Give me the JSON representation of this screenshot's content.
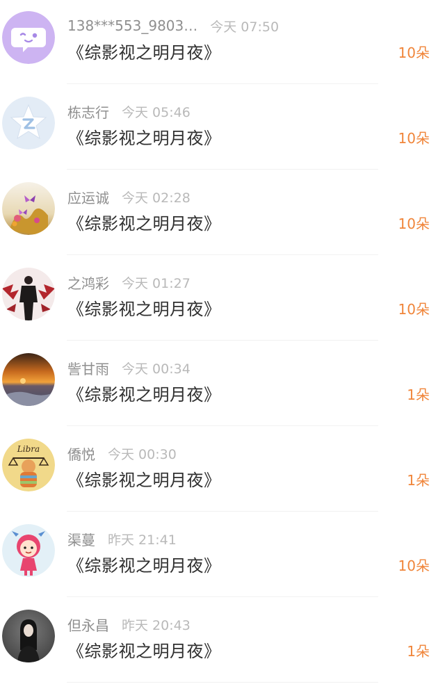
{
  "gift_list": {
    "items": [
      {
        "user": "138***553_9803…",
        "time": "今天 07:50",
        "book": "《综影视之明月夜》",
        "gift": "10朵",
        "avatar": "wechat-smiley-avatar"
      },
      {
        "user": "栋志行",
        "time": "今天 05:46",
        "book": "《综影视之明月夜》",
        "gift": "10朵",
        "avatar": "qzone-star-avatar"
      },
      {
        "user": "应运诚",
        "time": "今天 02:28",
        "book": "《综影视之明月夜》",
        "gift": "10朵",
        "avatar": "butterfly-flowers-avatar"
      },
      {
        "user": "之鸿彩",
        "time": "今天 01:27",
        "book": "《综影视之明月夜》",
        "gift": "10朵",
        "avatar": "man-in-black-avatar"
      },
      {
        "user": "訾甘雨",
        "time": "今天 00:34",
        "book": "《综影视之明月夜》",
        "gift": "1朵",
        "avatar": "sunset-sea-avatar"
      },
      {
        "user": "僑悦",
        "time": "今天 00:30",
        "book": "《综影视之明月夜》",
        "gift": "1朵",
        "avatar": "libra-cartoon-avatar",
        "avatar_text": "Libra"
      },
      {
        "user": "渠蔓",
        "time": "昨天 21:41",
        "book": "《综影视之明月夜》",
        "gift": "10朵",
        "avatar": "pink-cartoon-girl-avatar"
      },
      {
        "user": "但永昌",
        "time": "昨天 20:43",
        "book": "《综影视之明月夜》",
        "gift": "1朵",
        "avatar": "woman-portrait-avatar"
      }
    ]
  },
  "colors": {
    "gift_orange": "#f0853a",
    "name_gray": "#8f8f8f",
    "time_gray": "#b9b9b9",
    "title_dark": "#2f2f2f"
  }
}
